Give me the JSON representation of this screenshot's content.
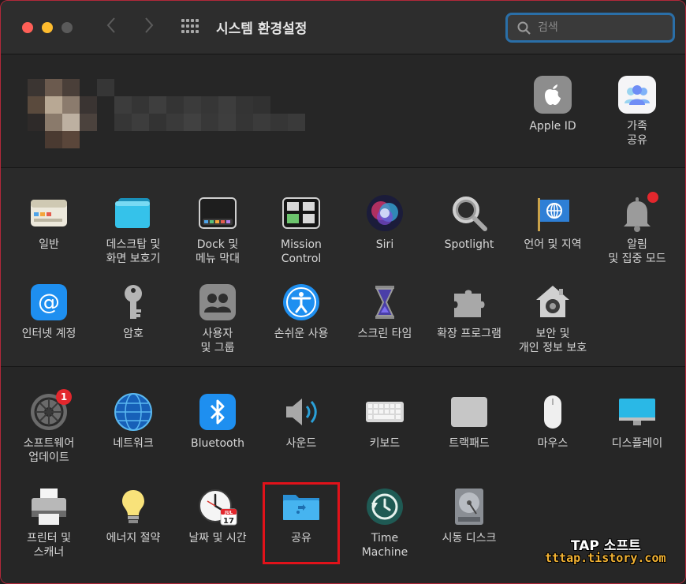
{
  "window": {
    "title": "시스템 환경설정"
  },
  "search": {
    "placeholder": "검색"
  },
  "account": {
    "items": [
      {
        "label": "Apple ID"
      },
      {
        "label": "가족\n공유"
      }
    ]
  },
  "section2": {
    "items": [
      {
        "label": "일반",
        "icon": "general-icon"
      },
      {
        "label": "데스크탑 및\n화면 보호기",
        "icon": "desktop-icon"
      },
      {
        "label": "Dock 및\n메뉴 막대",
        "icon": "dock-icon"
      },
      {
        "label": "Mission\nControl",
        "icon": "mission-control-icon"
      },
      {
        "label": "Siri",
        "icon": "siri-icon"
      },
      {
        "label": "Spotlight",
        "icon": "spotlight-icon"
      },
      {
        "label": "언어 및 지역",
        "icon": "globe-flag-icon"
      },
      {
        "label": "알림\n및 집중 모드",
        "icon": "bell-icon"
      },
      {
        "label": "인터넷 계정",
        "icon": "at-icon"
      },
      {
        "label": "암호",
        "icon": "key-icon"
      },
      {
        "label": "사용자\n및 그룹",
        "icon": "users-icon"
      },
      {
        "label": "손쉬운 사용",
        "icon": "accessibility-icon"
      },
      {
        "label": "스크린 타임",
        "icon": "hourglass-icon"
      },
      {
        "label": "확장 프로그램",
        "icon": "puzzle-icon"
      },
      {
        "label": "보안 및\n개인 정보 보호",
        "icon": "house-lock-icon"
      }
    ]
  },
  "section3": {
    "items": [
      {
        "label": "소프트웨어\n업데이트",
        "icon": "software-update-icon",
        "badge": "1"
      },
      {
        "label": "네트워크",
        "icon": "network-globe-icon"
      },
      {
        "label": "Bluetooth",
        "icon": "bluetooth-icon"
      },
      {
        "label": "사운드",
        "icon": "speaker-icon"
      },
      {
        "label": "키보드",
        "icon": "keyboard-icon"
      },
      {
        "label": "트랙패드",
        "icon": "trackpad-icon"
      },
      {
        "label": "마우스",
        "icon": "mouse-icon"
      },
      {
        "label": "디스플레이",
        "icon": "display-icon"
      },
      {
        "label": "프린터 및\n스캐너",
        "icon": "printer-icon"
      },
      {
        "label": "에너지 절약",
        "icon": "lightbulb-icon"
      },
      {
        "label": "날짜 및 시간",
        "icon": "clock-calendar-icon",
        "calendar_month": "JUL",
        "calendar_day": "17"
      },
      {
        "label": "공유",
        "icon": "sharing-folder-icon"
      },
      {
        "label": "Time\nMachine",
        "icon": "time-machine-icon"
      },
      {
        "label": "시동 디스크",
        "icon": "disk-icon"
      }
    ]
  },
  "watermark": {
    "line1": "TAP 소프트",
    "line2": "tttap.tistory.com"
  },
  "colors": {
    "highlight": "#e0121a",
    "accent": "#2a6fa8",
    "badge": "#e3272d"
  }
}
